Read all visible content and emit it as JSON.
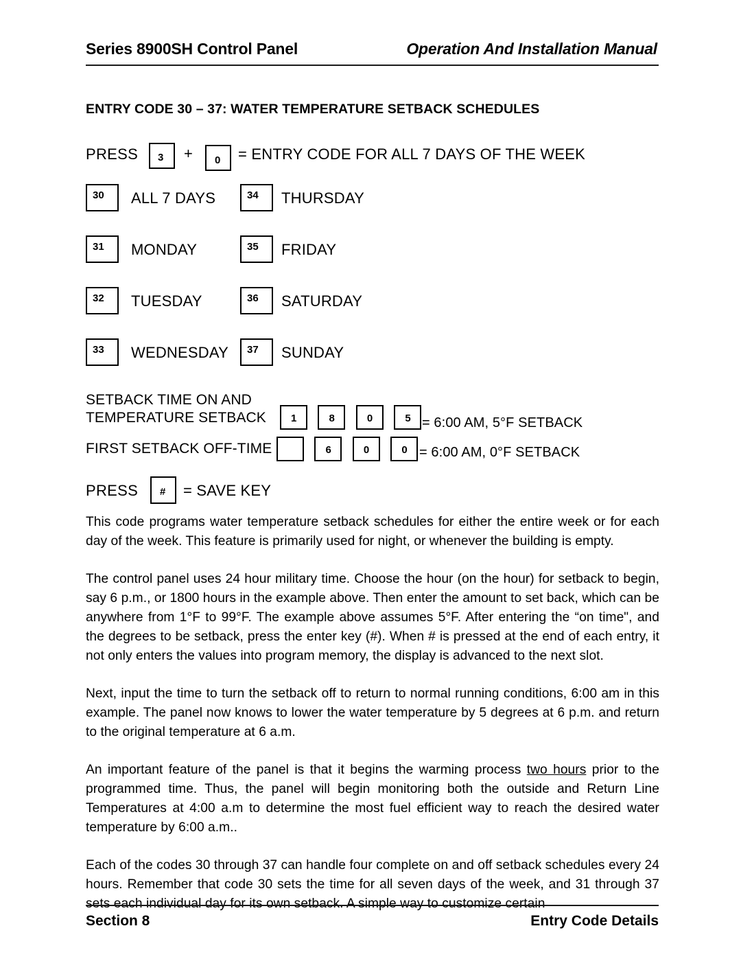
{
  "header": {
    "left_title": "Series 8900SH Control Panel",
    "right_title": "Operation And Installation Manual"
  },
  "section_heading": "ENTRY CODE 30 – 37:   WATER TEMPERATURE SETBACK SCHEDULES",
  "press_row": {
    "label": "PRESS",
    "key1": "3",
    "plus": "+",
    "key2": "0",
    "tail": "= ENTRY CODE FOR ALL 7 DAYS OF THE WEEK"
  },
  "day_codes": [
    {
      "code_left": "30",
      "label_left": "ALL 7 DAYS",
      "code_right": "34",
      "label_right": "THURSDAY"
    },
    {
      "code_left": "31",
      "label_left": "MONDAY",
      "code_right": "35",
      "label_right": "FRIDAY"
    },
    {
      "code_left": "32",
      "label_left": "TUESDAY",
      "code_right": "36",
      "label_right": "SATURDAY"
    },
    {
      "code_left": "33",
      "label_left": "WEDNESDAY",
      "code_right": "37",
      "label_right": "SUNDAY"
    }
  ],
  "setback": {
    "label_line1": "SETBACK TIME ON AND",
    "label_line2": "TEMPERATURE SETBACK",
    "on_digits": [
      "1",
      "8",
      "0",
      "5"
    ],
    "on_result": "= 6:00 AM, 5°F SETBACK",
    "off_label": "FIRST SETBACK OFF-TIME",
    "off_digits": [
      "",
      "6",
      "0",
      "0"
    ],
    "off_result": "= 6:00 AM, 0°F SETBACK"
  },
  "save_row": {
    "label": "PRESS",
    "key": "#",
    "tail": "= SAVE KEY"
  },
  "paragraphs": {
    "p1": "This code programs water temperature setback schedules for either the entire week or for each day of the week. This feature is primarily used for night, or whenever the building is empty.",
    "p2": "The control panel uses 24 hour military time. Choose the hour (on the hour) for setback to begin, say 6 p.m., or 1800 hours in the example above. Then enter the amount to set back, which can be anywhere from 1°F to 99°F. The example above assumes 5°F.  After entering the “on time\", and the degrees to be setback, press the enter key (#).  When # is pressed at the end of each entry, it not only enters the values into program memory, the display is advanced to the next slot.",
    "p3": "Next, input the time to turn the setback off to return to normal running conditions, 6:00 am in this example.  The panel now knows to lower the water temperature by 5 degrees at 6 p.m. and return to the original temperature at 6 a.m.",
    "p4_before": "An important feature of the panel is that it begins the warming process ",
    "p4_underline": "two hours",
    "p4_after": " prior to the programmed time. Thus, the panel will begin monitoring both the outside and Return Line Temperatures at 4:00 a.m to determine the most fuel efficient way to reach the desired water temperature by 6:00 a.m..",
    "p5": "Each of the codes 30 through 37 can handle four complete on and off setback schedules every 24 hours.  Remember that code 30 sets the time for all seven days of the week, and 31 through 37 sets each individual day for its own setback.  A simple way to customize certain"
  },
  "footer": {
    "left": "Section 8",
    "right": "Entry Code Details"
  }
}
